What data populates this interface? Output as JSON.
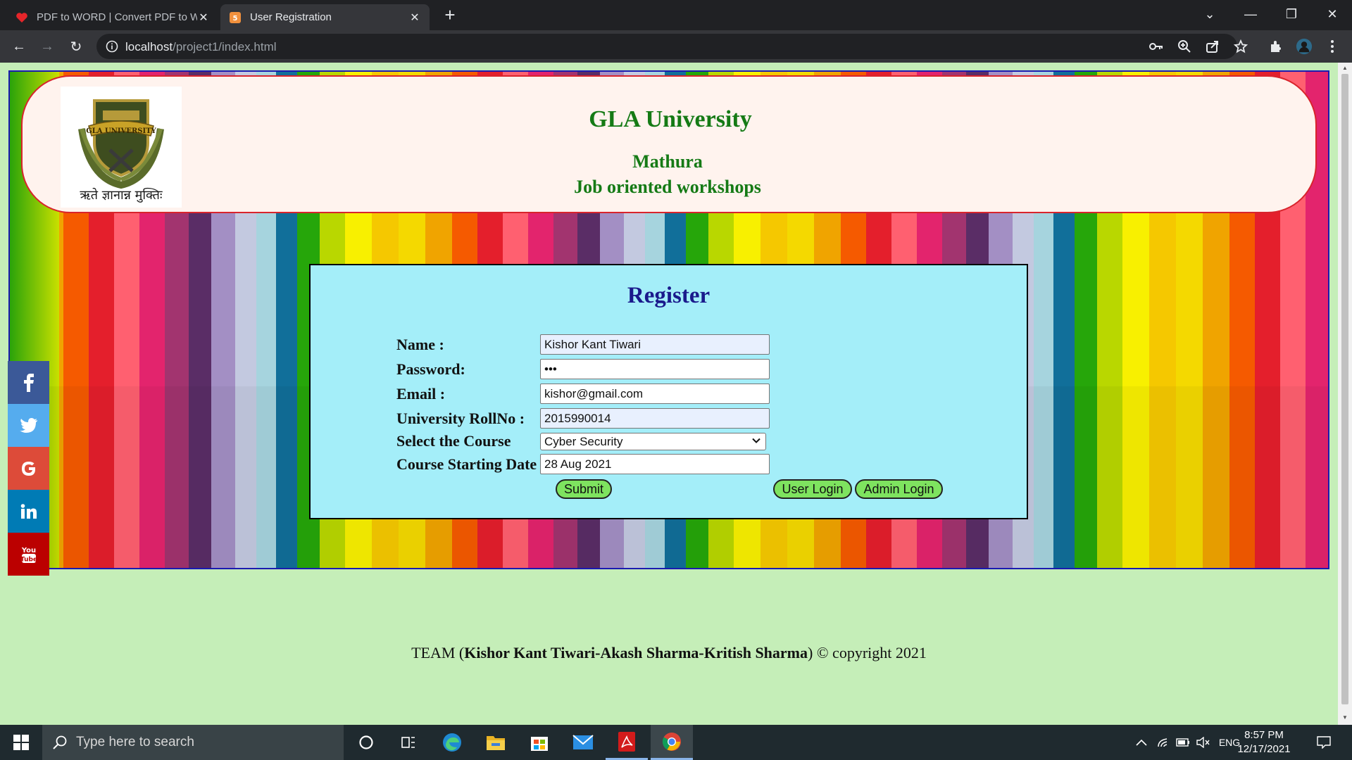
{
  "browser": {
    "tabs": [
      {
        "title": "PDF to WORD | Convert PDF to W",
        "active": false
      },
      {
        "title": "User Registration",
        "active": true
      }
    ],
    "url_host": "localhost",
    "url_path": "/project1/index.html"
  },
  "header": {
    "university": "GLA University",
    "city": "Mathura",
    "tagline": "Job oriented workshops",
    "logo_motto": "ऋते ज्ञानान्न मुक्तिः",
    "logo_banner": "GLA UNIVERSITY"
  },
  "form": {
    "title": "Register",
    "fields": {
      "name": {
        "label": "Name :",
        "value": "Kishor Kant Tiwari"
      },
      "password": {
        "label": "Password:",
        "value": "•••"
      },
      "email": {
        "label": "Email :",
        "value": "kishor@gmail.com"
      },
      "rollno": {
        "label": "University RollNo :",
        "value": "2015990014"
      },
      "course": {
        "label": "Select the Course",
        "value": "Cyber Security"
      },
      "start_date": {
        "label": "Course Starting Date",
        "value": "28 Aug 2021"
      }
    },
    "buttons": {
      "submit": "Submit",
      "user_login": "User Login",
      "admin_login": "Admin Login"
    }
  },
  "social": [
    {
      "name": "facebook",
      "color": "#3b5998"
    },
    {
      "name": "twitter",
      "color": "#55acee"
    },
    {
      "name": "google",
      "color": "#dd4b39"
    },
    {
      "name": "linkedin",
      "color": "#007bb5"
    },
    {
      "name": "youtube",
      "color": "#bb0000"
    }
  ],
  "footer": {
    "prefix": "TEAM (",
    "names": "Kishor Kant Tiwari-Akash Sharma-Kritish Sharma",
    "suffix": ") © copyright 2021"
  },
  "taskbar": {
    "search_placeholder": "Type here to search",
    "language": "ENG",
    "time": "8:57 PM",
    "date": "12/17/2021"
  }
}
